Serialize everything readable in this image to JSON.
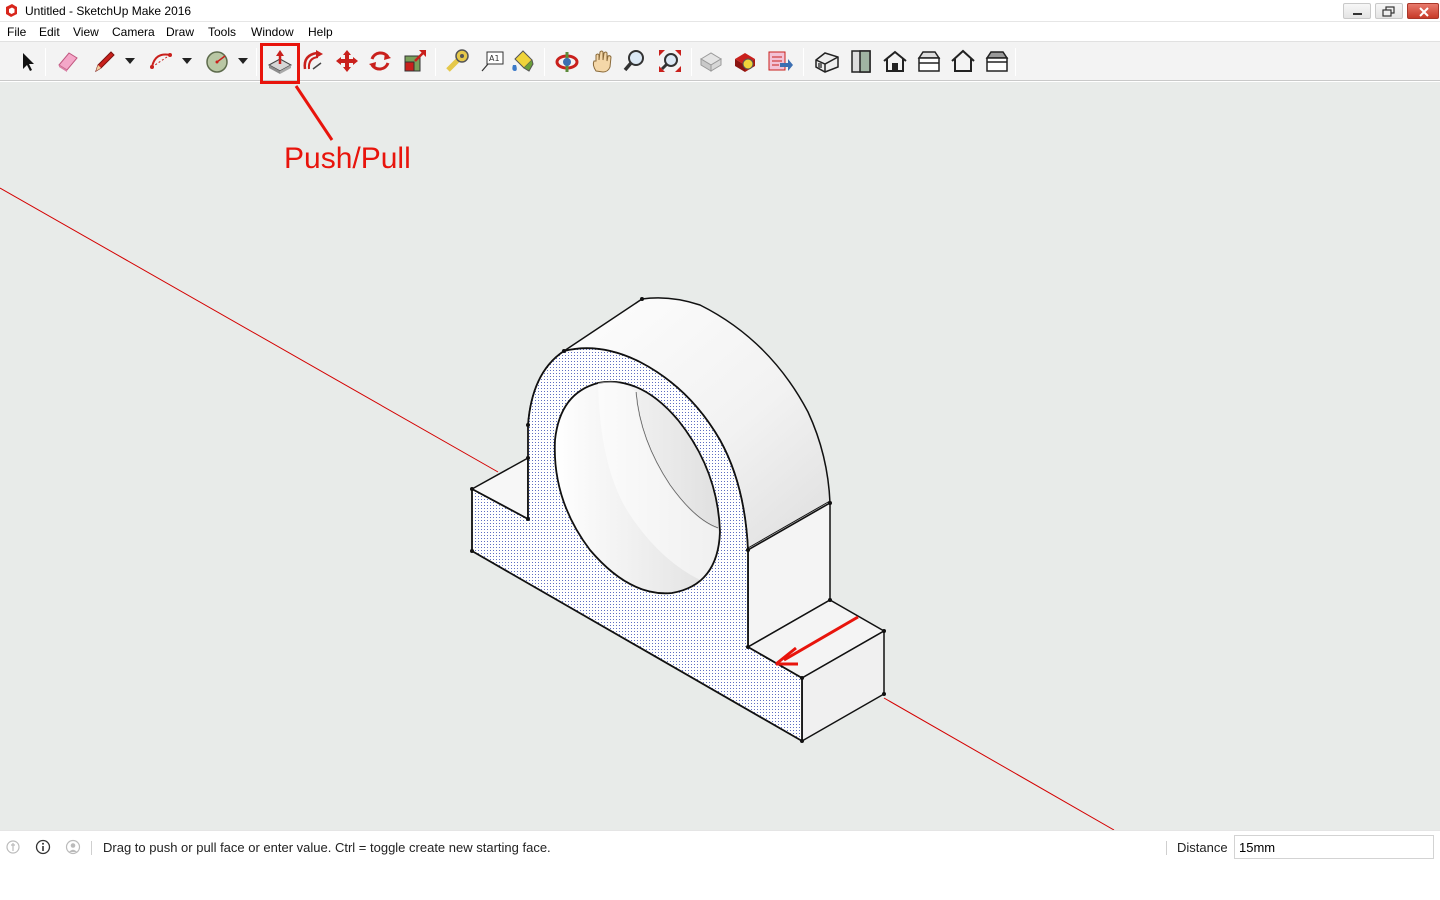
{
  "window": {
    "title": "Untitled - SketchUp Make 2016",
    "app_icon": "sketchup-logo-icon",
    "controls": [
      "minimize-icon",
      "maximize-icon",
      "close-icon"
    ]
  },
  "menu": {
    "items": [
      "File",
      "Edit",
      "View",
      "Camera",
      "Draw",
      "Tools",
      "Window",
      "Help"
    ]
  },
  "toolbar": {
    "groups": [
      [
        "select-arrow-icon"
      ],
      [
        "eraser-icon",
        "pencil-icon",
        "arc-icon",
        "circle-icon"
      ],
      [
        "push-pull-icon",
        "offset-icon",
        "move-icon",
        "rotate-icon",
        "scale-icon"
      ],
      [
        "tape-measure-icon",
        "text-label-icon",
        "paint-bucket-icon"
      ],
      [
        "orbit-icon",
        "pan-icon",
        "zoom-icon",
        "zoom-extents-icon"
      ],
      [
        "warehouse-icon",
        "extension-warehouse-icon",
        "send-to-layout-icon"
      ],
      [
        "iso-view-icon",
        "front-view-icon",
        "top-view-icon",
        "right-view-icon",
        "back-view-icon",
        "left-view-icon"
      ]
    ],
    "active_tool": "push-pull-icon"
  },
  "annotation": {
    "label": "Push/Pull",
    "color": "#e8140c"
  },
  "viewport": {
    "background": "#e8ebe9",
    "red_axis_color": "#d40000",
    "model": "pillow block with circular hole and base"
  },
  "status": {
    "icons": [
      "geo-location-icon",
      "info-icon",
      "user-icon"
    ],
    "message": "Drag to push or pull face or enter value.  Ctrl = toggle create new starting face.",
    "vcb_label": "Distance",
    "vcb_value": "15mm"
  }
}
